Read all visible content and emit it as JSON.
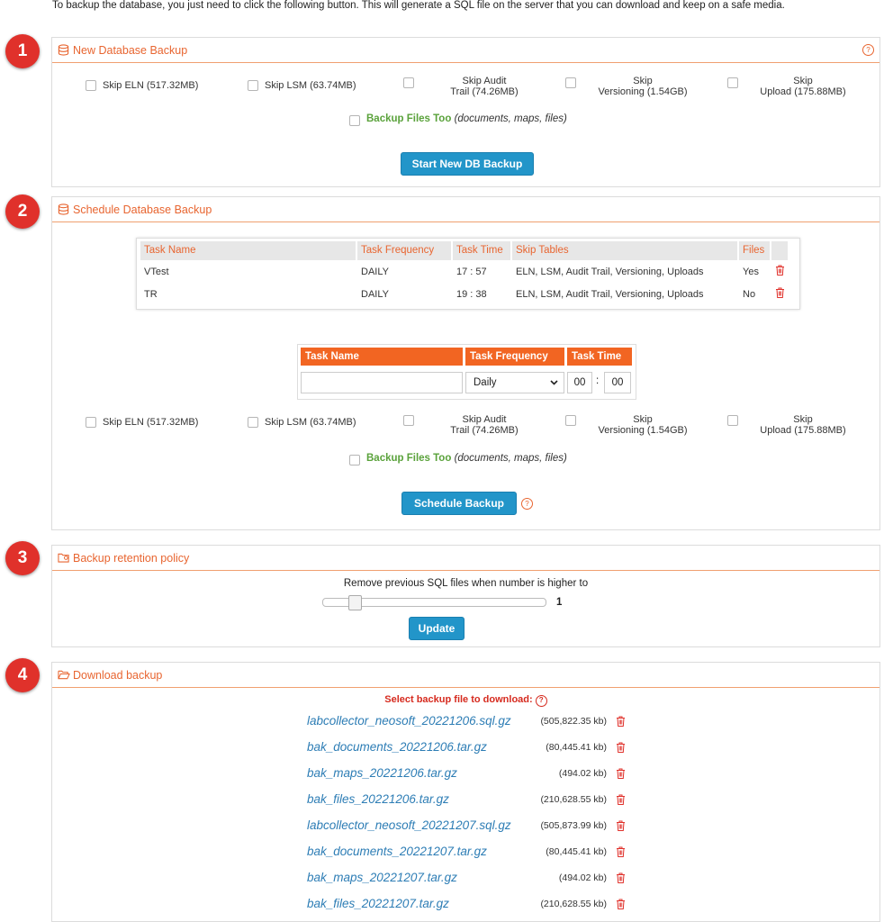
{
  "intro": "To backup the database, you just need to click the following button. This will generate a SQL file on the server that you can download and keep on a safe media.",
  "badges": [
    "1",
    "2",
    "3",
    "4"
  ],
  "new_backup": {
    "title": "New Database Backup",
    "help": "?",
    "skip": [
      {
        "label": "Skip ELN (517.32MB)"
      },
      {
        "label": "Skip LSM (63.74MB)"
      },
      {
        "line1": "Skip Audit",
        "line2": "Trail (74.26MB)"
      },
      {
        "line1": "Skip",
        "line2": "Versioning (1.54GB)"
      },
      {
        "line1": "Skip",
        "line2": "Upload (175.88MB)"
      }
    ],
    "files_label": "Backup Files Too",
    "files_hint": "(documents, maps, files)",
    "button": "Start New DB Backup"
  },
  "schedule": {
    "title": "Schedule Database Backup",
    "table_headers": [
      "Task Name",
      "Task Frequency",
      "Task Time",
      "Skip Tables",
      "Files"
    ],
    "rows": [
      {
        "name": "VTest",
        "freq": "DAILY",
        "time": "17 : 57",
        "skip": "ELN, LSM, Audit Trail, Versioning, Uploads",
        "files": "Yes"
      },
      {
        "name": "TR",
        "freq": "DAILY",
        "time": "19 : 38",
        "skip": "ELN, LSM, Audit Trail, Versioning, Uploads",
        "files": "No"
      }
    ],
    "form_headers": [
      "Task Name",
      "Task Frequency",
      "Task Time"
    ],
    "frequency_value": "Daily",
    "hour": "00",
    "minute": "00",
    "time_sep": ":",
    "skip": [
      {
        "label": "Skip ELN (517.32MB)"
      },
      {
        "label": "Skip LSM (63.74MB)"
      },
      {
        "line1": "Skip Audit",
        "line2": "Trail (74.26MB)"
      },
      {
        "line1": "Skip",
        "line2": "Versioning (1.54GB)"
      },
      {
        "line1": "Skip",
        "line2": "Upload (175.88MB)"
      }
    ],
    "files_label": "Backup Files Too",
    "files_hint": "(documents, maps, files)",
    "button": "Schedule Backup",
    "help": "?"
  },
  "retention": {
    "title": "Backup retention policy",
    "text": "Remove previous SQL files when number is higher to",
    "value": "1",
    "button": "Update"
  },
  "download": {
    "title": "Download backup",
    "select_label": "Select backup file to download:",
    "help": "?",
    "files": [
      {
        "name": "labcollector_neosoft_20221206.sql.gz",
        "size": "(505,822.35 kb)"
      },
      {
        "name": "bak_documents_20221206.tar.gz",
        "size": "(80,445.41 kb)"
      },
      {
        "name": "bak_maps_20221206.tar.gz",
        "size": "(494.02 kb)"
      },
      {
        "name": "bak_files_20221206.tar.gz",
        "size": "(210,628.55 kb)"
      },
      {
        "name": "labcollector_neosoft_20221207.sql.gz",
        "size": "(505,873.99 kb)"
      },
      {
        "name": "bak_documents_20221207.tar.gz",
        "size": "(80,445.41 kb)"
      },
      {
        "name": "bak_maps_20221207.tar.gz",
        "size": "(494.02 kb)"
      },
      {
        "name": "bak_files_20221207.tar.gz",
        "size": "(210,628.55 kb)"
      }
    ]
  }
}
